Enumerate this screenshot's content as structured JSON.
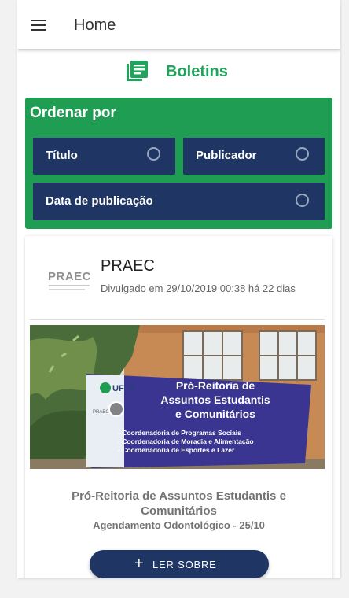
{
  "appbar": {
    "title": "Home"
  },
  "page": {
    "title": "Boletins"
  },
  "sort": {
    "title": "Ordenar por",
    "options": [
      {
        "label": "Título",
        "selected": false
      },
      {
        "label": "Publicador",
        "selected": false
      },
      {
        "label": "Data de publicação",
        "selected": false
      }
    ]
  },
  "card": {
    "logo_text": "PRAEC",
    "author": "PRAEC",
    "date": "Divulgado em 29/10/2019 00:38 há 22 dias",
    "image": {
      "banner_logo": "UFLA",
      "banner_lines": [
        "Pró-Reitoria de",
        "Assuntos Estudantis",
        "e Comunitários"
      ],
      "bullets": [
        "- Coordenadoria de Programas Sociais",
        "- Coordenadoria de Moradia e Alimentação",
        "- Coordenadoria de Esportes e Lazer"
      ],
      "side_tag": "PRAEC"
    },
    "title": "Pró-Reitoria de Assuntos Estudantis e Comunitários",
    "subtitle": "Agendamento Odontológico - 25/10",
    "button_label": "LER SOBRE"
  },
  "colors": {
    "green": "#1f9d53",
    "navy": "#1f3664"
  },
  "icons": {
    "menu": "menu-icon",
    "doc": "document-list-icon",
    "plus": "plus-icon",
    "radio": "radio-unchecked-icon"
  }
}
